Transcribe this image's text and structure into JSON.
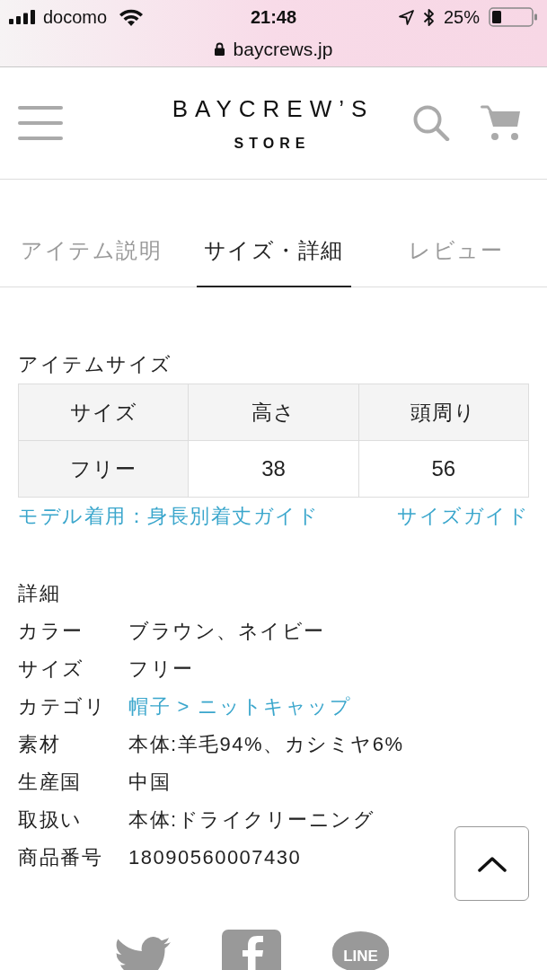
{
  "status_bar": {
    "carrier": "docomo",
    "time": "21:48",
    "battery": "25%"
  },
  "address_bar": {
    "url": "baycrews.jp"
  },
  "header": {
    "logo": {
      "line_1": "BAYCREW’S",
      "line_2": "STORE"
    }
  },
  "tabs": [
    {
      "label": "アイテム説明",
      "selected": false
    },
    {
      "label": "サイズ・詳細",
      "selected": true
    },
    {
      "label": "レビュー",
      "selected": false
    }
  ],
  "item_size": {
    "title": "アイテムサイズ",
    "columns": [
      "サイズ",
      "高さ",
      "頭周り"
    ],
    "rows": [
      [
        "フリー",
        "38",
        "56"
      ]
    ],
    "links": [
      "モデル着用：身長別着丈ガイド",
      "サイズガイド"
    ]
  },
  "details": {
    "title": "詳細",
    "rows": [
      {
        "label": "カラー",
        "value": "ブラウン、ネイビー",
        "kind": "text"
      },
      {
        "label": "サイズ",
        "value": "フリー",
        "kind": "text"
      },
      {
        "label": "カテゴリ",
        "value": "帽子 > ニットキャップ",
        "kind": "link"
      },
      {
        "label": "素材",
        "value": "本体:羊毛94%、カシミヤ6%",
        "kind": "text"
      },
      {
        "label": "生産国",
        "value": "中国",
        "kind": "text"
      },
      {
        "label": "取扱い",
        "value": "本体:ドライクリーニング",
        "kind": "text"
      },
      {
        "label": "商品番号",
        "value": "18090560007430",
        "kind": "text"
      }
    ]
  },
  "share": [
    {
      "kind": "bird"
    },
    {
      "kind": "f"
    },
    {
      "kind": "line",
      "label": "LINE"
    }
  ]
}
